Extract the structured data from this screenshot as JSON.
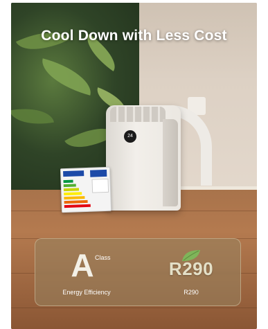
{
  "headline": "Cool Down with Less Cost",
  "product": {
    "display_text": "24"
  },
  "rating_panel": {
    "energy_grade": "A",
    "grade_suffix": "Class",
    "grade_caption": "Energy Efficiency",
    "refrigerant_name": "R290",
    "refrigerant_caption": "R290"
  },
  "icons": {
    "refrigerant": "leaf-icon"
  },
  "colors": {
    "headline": "#ffffff",
    "panel_bg": "#96825f",
    "grade": "#f3f0e6",
    "refrigerant_text": "#e4e0c8",
    "leaf": "#7fb55a"
  }
}
